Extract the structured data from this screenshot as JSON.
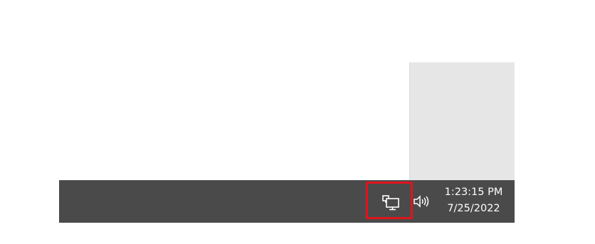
{
  "taskbar": {
    "tray": {
      "network_icon": "network-monitor-icon",
      "volume_icon": "speaker-volume-icon"
    },
    "clock": {
      "time": "1:23:15 PM",
      "date": "7/25/2022"
    }
  },
  "highlight": {
    "target": "network-monitor-icon",
    "color": "#e0131d"
  },
  "colors": {
    "taskbar_bg": "#4a4a4a",
    "panel_bg": "#e6e6e6"
  }
}
